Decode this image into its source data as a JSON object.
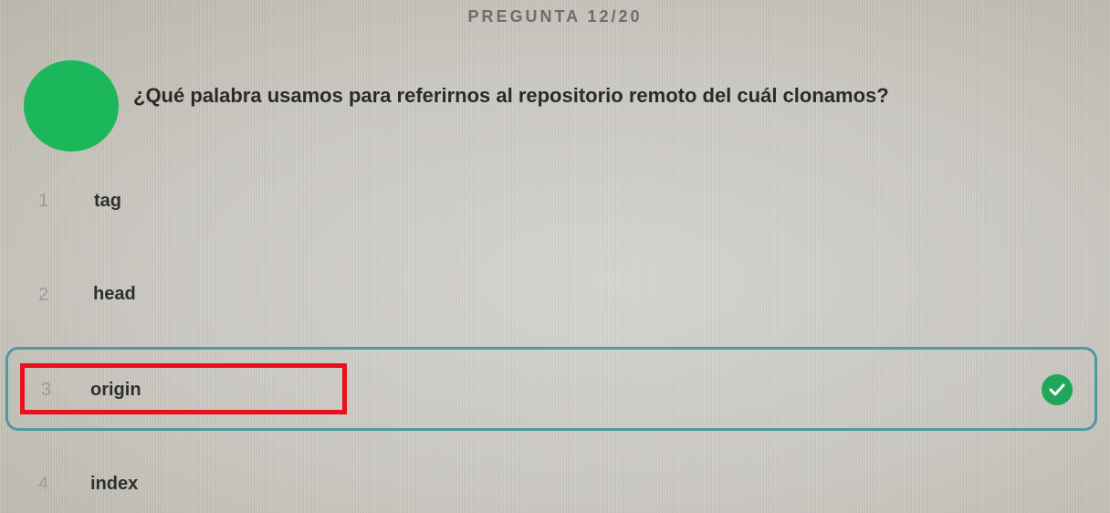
{
  "header": {
    "title": "PREGUNTA 12/20"
  },
  "question": {
    "text": "¿Qué palabra usamos para referirnos al repositorio remoto del cuál clonamos?"
  },
  "options": [
    {
      "number": "1",
      "label": "tag"
    },
    {
      "number": "2",
      "label": "head"
    },
    {
      "number": "3",
      "label": "origin"
    },
    {
      "number": "4",
      "label": "index"
    }
  ],
  "selected_option": 3,
  "colors": {
    "avatar": "#1cb75a",
    "selected_border": "#4f9aa0",
    "check": "#20a65a",
    "highlight_annotation": "#e8101a"
  },
  "icons": {
    "selected_indicator": "check-circle-icon"
  }
}
